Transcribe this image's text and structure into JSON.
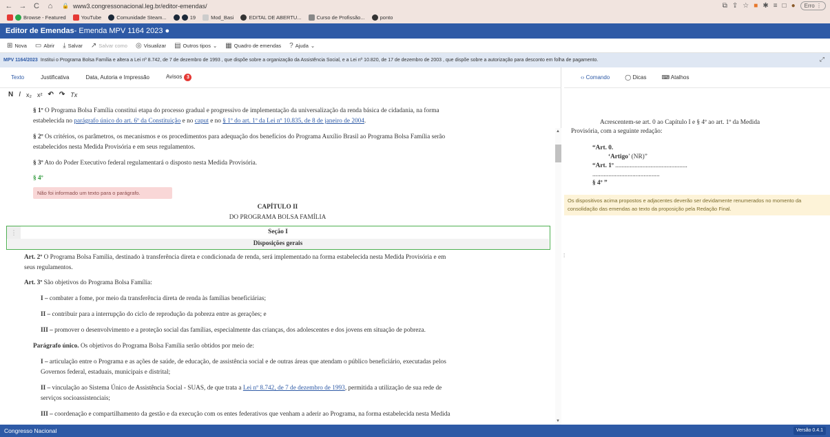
{
  "browser": {
    "url": "www3.congressonacional.leg.br/editor-emendas/",
    "profile": "Erro",
    "bookmarks": [
      "Browse - Featured",
      "YouTube",
      "Comunidade Steam...",
      "19",
      "Mod_Basi",
      "EDITAL DE ABERTU...",
      "Curso de Profissão...",
      "ponto"
    ]
  },
  "header": {
    "app_title": "Editor de Emendas",
    "doc_title": " - Emenda MPV 1164 2023 ●"
  },
  "toolbar": {
    "nova": "Nova",
    "abrir": "Abrir",
    "salvar": "Salvar",
    "salvar_como": "Salvar como",
    "visualizar": "Visualizar",
    "outros_tipos": "Outros tipos",
    "quadro": "Quadro de emendas",
    "ajuda": "Ajuda"
  },
  "mpv": {
    "badge": "MPV 1164/2023",
    "text": "Institui o Programa Bolsa Família e altera a Lei nº 8.742, de 7 de dezembro de 1993 , que dispõe sobre a organização da Assistência Social, e a Lei nº 10.820, de 17 de dezembro de 2003 , que dispõe sobre a autorização para desconto em folha de pagamento."
  },
  "left_tabs": {
    "texto": "Texto",
    "justificativa": "Justificativa",
    "data": "Data, Autoria e Impressão",
    "avisos": "Avisos",
    "avisos_count": "3"
  },
  "format": {
    "bold": "N",
    "italic": "I",
    "sub": "x₂",
    "sup": "x²",
    "undo": "↶",
    "redo": "↷",
    "clear": "Tx"
  },
  "doc": {
    "p1_label": "§ 1º",
    "p1_text": " O Programa Bolsa Família constitui etapa do processo gradual e progressivo de implementação da universalização da renda básica de cidadania, na forma",
    "p1_line2_a": "estabelecida no ",
    "p1_link1": "parágrafo único do art. 6º da Constituição",
    "p1_mid": " e no ",
    "p1_link2": "caput",
    "p1_mid2": " e no ",
    "p1_link3": "§ 1º do art. 1º da Lei nº 10.835, de 8 de janeiro de 2004",
    "p1_end": ".",
    "p2_label": "§ 2º",
    "p2_text": " Os critérios, os parâmetros, os mecanismos e os procedimentos para adequação dos benefícios do Programa Auxílio Brasil ao Programa Bolsa Família serão",
    "p2_line2": "estabelecidos nesta Medida Provisória e em seus regulamentos.",
    "p3_label": "§ 3º",
    "p3_text": " Ato do Poder Executivo federal regulamentará o disposto nesta Medida Provisória.",
    "p4_label": "§ 4º",
    "warning": "Não foi informado um texto para o parágrafo.",
    "chapter": "CAPÍTULO II",
    "chapter_name": "DO PROGRAMA BOLSA FAMÍLIA",
    "section": "Seção I",
    "section_name": "Disposições gerais",
    "art2_label": "Art. 2º",
    "art2_text": " O Programa Bolsa Família, destinado à transferência direta e condicionada de renda, será implementado na forma estabelecida nesta Medida Provisória e em",
    "art2_line2": "seus regulamentos.",
    "art3_label": "Art. 3º",
    "art3_text": " São objetivos do Programa Bolsa Família:",
    "i1_label": "I – ",
    "i1_text": "combater a fome, por meio da transferência direta de renda às famílias beneficiárias;",
    "i2_label": "II – ",
    "i2_text": "contribuir para a interrupção do ciclo de reprodução da pobreza entre as gerações; e",
    "i3_label": "III – ",
    "i3_text": "promover o desenvolvimento e a proteção social das famílias, especialmente das crianças, dos adolescentes e dos jovens em situação de pobreza.",
    "pu_label": "Parágrafo único.",
    "pu_text": " Os objetivos do Programa Bolsa Família serão obtidos por meio de:",
    "j1_label": "I – ",
    "j1_text": "articulação entre o Programa e as ações de saúde, de educação, de assistência social e de outras áreas que atendam o público beneficiário, executadas pelos",
    "j1_line2": "Governos federal, estaduais, municipais e distrital;",
    "j2_label": "II – ",
    "j2_text": "vinculação ao Sistema Único de Assistência Social - SUAS, de que trata a ",
    "j2_link": "Lei nº 8.742, de 7 de dezembro de 1993",
    "j2_end": ", permitida a utilização de sua rede de",
    "j2_line2": "serviços socioassistenciais;",
    "j3_label": "III – ",
    "j3_text": "coordenação e compartilhamento da gestão e da execução com os entes federativos que venham a aderir ao Programa, na forma estabelecida nesta Medida"
  },
  "right_tabs": {
    "comando": "Comando",
    "dicas": "Dicas",
    "atalhos": "Atalhos"
  },
  "command": {
    "line1": "Acrescentem-se art. 0 ao Capítulo I e § 4º ao art. 1º da Medida",
    "line2": "Provisória, com a seguinte redação:",
    "art0": "“Art. 0.",
    "artigo": "‘Artigo",
    "nr": "’ (NR)”",
    "art1": "“Art. 1º",
    "art1_dots": " .............................................",
    "dots2": "..........................................",
    "p4": "§ 4º ”"
  },
  "note": "Os dispositivos acima propostos e adjacentes deverão ser devidamente renumerados no momento da consolidação das emendas ao texto da proposição pela Redação Final.",
  "footer": {
    "org": "Congresso Nacional",
    "version": "Versão 0.4.1"
  }
}
